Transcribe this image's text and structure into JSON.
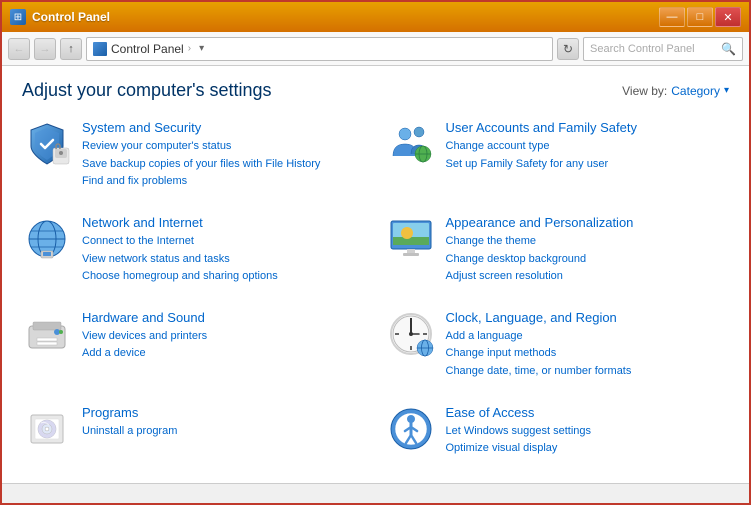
{
  "window": {
    "title": "Control Panel",
    "icon": "⊞"
  },
  "titlebar_buttons": {
    "minimize": "—",
    "maximize": "□",
    "close": "✕"
  },
  "addressbar": {
    "back_title": "Back",
    "forward_title": "Forward",
    "up_title": "Up",
    "breadcrumb_icon_alt": "Control Panel folder icon",
    "breadcrumb_path": "Control Panel",
    "breadcrumb_arrow": "›",
    "refresh_title": "Refresh",
    "search_placeholder": "Search Control Panel"
  },
  "header": {
    "page_title": "Adjust your computer's settings",
    "view_by_label": "View by:",
    "view_by_value": "Category",
    "view_by_chevron": "▾"
  },
  "categories": [
    {
      "id": "system-security",
      "title": "System and Security",
      "links": [
        "Review your computer's status",
        "Save backup copies of your files with File History",
        "Find and fix problems"
      ],
      "icon_type": "shield"
    },
    {
      "id": "user-accounts",
      "title": "User Accounts and Family Safety",
      "links": [
        "Change account type",
        "Set up Family Safety for any user"
      ],
      "icon_type": "users"
    },
    {
      "id": "network-internet",
      "title": "Network and Internet",
      "links": [
        "Connect to the Internet",
        "View network status and tasks",
        "Choose homegroup and sharing options"
      ],
      "icon_type": "network"
    },
    {
      "id": "appearance-personalization",
      "title": "Appearance and Personalization",
      "links": [
        "Change the theme",
        "Change desktop background",
        "Adjust screen resolution"
      ],
      "icon_type": "appearance"
    },
    {
      "id": "hardware-sound",
      "title": "Hardware and Sound",
      "links": [
        "View devices and printers",
        "Add a device"
      ],
      "icon_type": "hardware"
    },
    {
      "id": "clock-language",
      "title": "Clock, Language, and Region",
      "links": [
        "Add a language",
        "Change input methods",
        "Change date, time, or number formats"
      ],
      "icon_type": "clock"
    },
    {
      "id": "programs",
      "title": "Programs",
      "links": [
        "Uninstall a program"
      ],
      "icon_type": "programs"
    },
    {
      "id": "ease-of-access",
      "title": "Ease of Access",
      "links": [
        "Let Windows suggest settings",
        "Optimize visual display"
      ],
      "icon_type": "ease"
    }
  ]
}
